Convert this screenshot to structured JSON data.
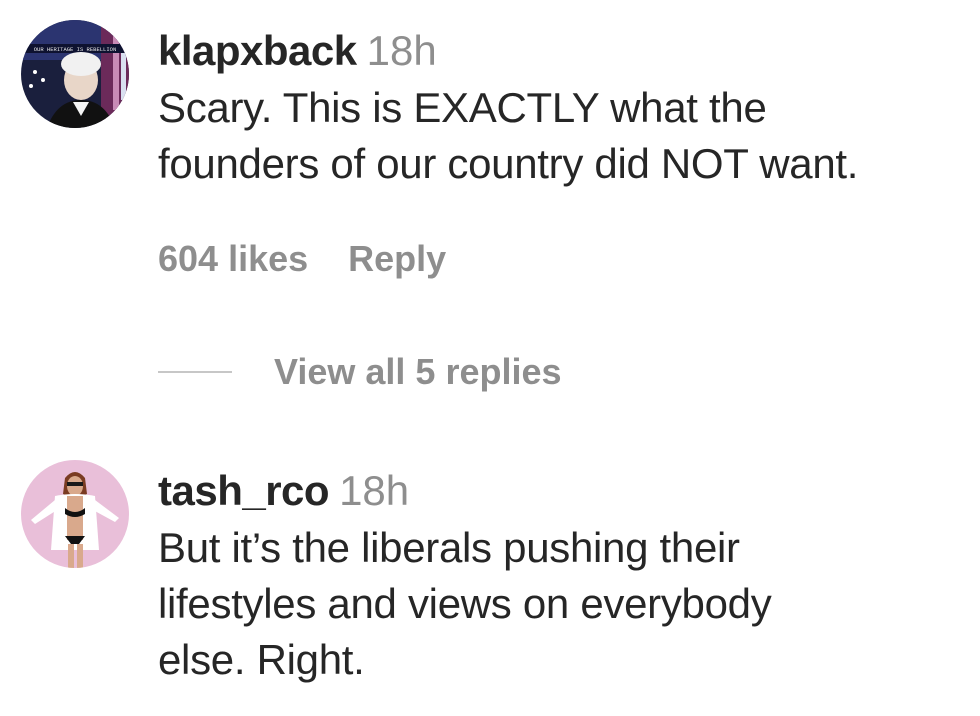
{
  "comments": [
    {
      "username": "klapxback",
      "time": "18h",
      "text_lines": [
        "Scary. This is EXACTLY what the",
        "founders of our country did NOT want."
      ],
      "likes": "604 likes",
      "reply_label": "Reply",
      "avatar_banner_text": "OUR HERITAGE IS REBELLION",
      "view_replies_label": "View all 5 replies"
    },
    {
      "username": "tash_rco",
      "time": "18h",
      "text_lines": [
        "But it’s the liberals pushing their",
        "lifestyles and views on everybody",
        "else. Right."
      ]
    }
  ],
  "colors": {
    "text_primary": "#262626",
    "text_secondary": "#8e8e8e",
    "divider": "#c7c7c7",
    "avatar2_bg": "#e9bfd9"
  }
}
